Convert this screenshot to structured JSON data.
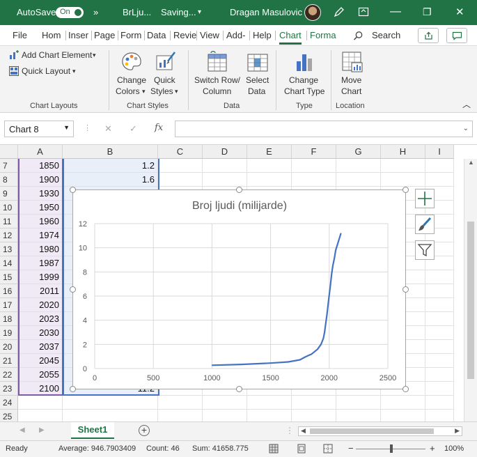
{
  "titlebar": {
    "autosave_label": "AutoSave",
    "autosave_state": "On",
    "more": "»",
    "doc_title": "BrLju...",
    "saving": "Saving...",
    "user_name": "Dragan Masulovic",
    "minimize": "—",
    "restore": "❐",
    "close": "✕"
  },
  "tabs": {
    "items": [
      "File",
      "Hom",
      "Inser",
      "Page",
      "Form",
      "Data",
      "Revie",
      "View",
      "Add-",
      "Help",
      "Chart",
      "Forma"
    ],
    "active": "Chart",
    "search": "Search"
  },
  "ribbon": {
    "add_chart_element": "Add Chart Element",
    "quick_layout": "Quick Layout",
    "change_colors_1": "Change",
    "change_colors_2": "Colors",
    "quick_styles_1": "Quick",
    "quick_styles_2": "Styles",
    "switch_1": "Switch Row/",
    "switch_2": "Column",
    "select_1": "Select",
    "select_2": "Data",
    "change_type_1": "Change",
    "change_type_2": "Chart Type",
    "move_1": "Move",
    "move_2": "Chart",
    "groups": {
      "chart_layouts": "Chart Layouts",
      "chart_styles": "Chart Styles",
      "data": "Data",
      "type": "Type",
      "location": "Location"
    }
  },
  "formula_bar": {
    "name_box": "Chart 8",
    "fx": "fx",
    "cancel": "✕",
    "enter": "✓",
    "value": ""
  },
  "grid": {
    "columns": [
      "A",
      "B",
      "C",
      "D",
      "E",
      "F",
      "G",
      "H",
      "I"
    ],
    "rows": [
      "7",
      "8",
      "9",
      "10",
      "11",
      "12",
      "13",
      "14",
      "15",
      "16",
      "17",
      "18",
      "19",
      "20",
      "21",
      "22",
      "23",
      "24",
      "25"
    ],
    "colA": [
      "1850",
      "1900",
      "1930",
      "1950",
      "1960",
      "1974",
      "1980",
      "1987",
      "1999",
      "2011",
      "2020",
      "2023",
      "2030",
      "2037",
      "2045",
      "2055",
      "2100",
      "",
      ""
    ],
    "colB_visible": [
      "1.2",
      "1.6",
      "",
      "",
      "",
      "",
      "",
      "",
      "",
      "",
      "",
      "",
      "",
      "",
      "",
      "",
      "11.2",
      "",
      ""
    ]
  },
  "chart_data": {
    "type": "scatter",
    "title": "Broj ljudi (milijarde)",
    "xlabel": "",
    "ylabel": "",
    "xlim": [
      0,
      2500
    ],
    "ylim": [
      0,
      12
    ],
    "x_ticks": [
      "0",
      "500",
      "1000",
      "1500",
      "2000",
      "2500"
    ],
    "y_ticks": [
      "0",
      "2",
      "4",
      "6",
      "8",
      "10",
      "12"
    ],
    "grid": true,
    "series": [
      {
        "color": "#4472C4",
        "x": [
          1000,
          1250,
          1500,
          1650,
          1750,
          1800,
          1850,
          1900,
          1930,
          1950,
          1960,
          1974,
          1980,
          1987,
          1999,
          2011,
          2020,
          2023,
          2030,
          2037,
          2045,
          2055,
          2100
        ],
        "y": [
          0.27,
          0.34,
          0.45,
          0.55,
          0.72,
          0.98,
          1.2,
          1.6,
          2.0,
          2.5,
          3.0,
          4.0,
          4.4,
          5.0,
          6.0,
          7.0,
          7.8,
          8.0,
          8.5,
          8.8,
          9.2,
          9.8,
          11.2
        ]
      }
    ]
  },
  "sheets": {
    "active": "Sheet1",
    "add": "+"
  },
  "status": {
    "ready": "Ready",
    "average": "Average: 946.7903409",
    "count": "Count: 46",
    "sum": "Sum: 41658.775",
    "zoom_minus": "−",
    "zoom_plus": "+",
    "zoom": "100%"
  }
}
